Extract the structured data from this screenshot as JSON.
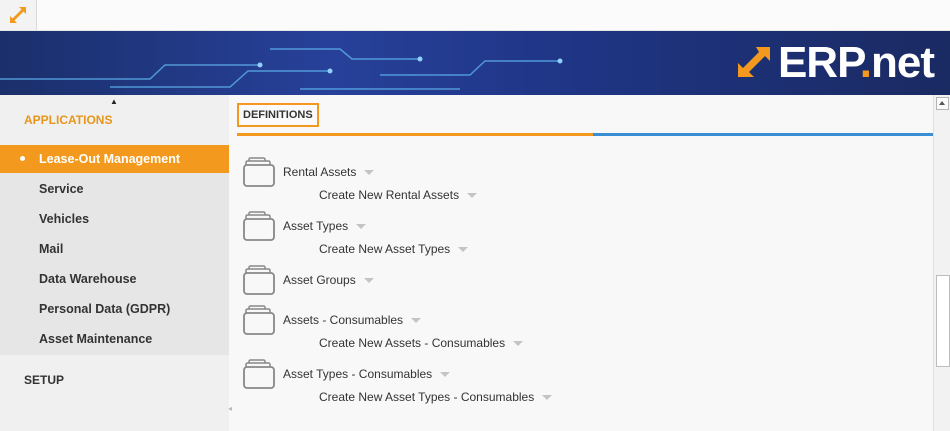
{
  "topbar": {
    "app_button_icon": "expand-arrow-icon"
  },
  "banner": {
    "logo_icon": "erp-logo-arrow-icon",
    "logo_text_main": "ERP",
    "logo_text_dot": ".",
    "logo_text_suffix": "net",
    "colors": {
      "orange": "#f39a1e",
      "navy": "#1f3585"
    }
  },
  "sidebar": {
    "scroll_up_icon": "triangle-up-icon",
    "applications_label": "APPLICATIONS",
    "items": [
      {
        "label": "Lease-Out Management",
        "active": true
      },
      {
        "label": "Service"
      },
      {
        "label": "Vehicles"
      },
      {
        "label": "Mail"
      },
      {
        "label": "Data Warehouse"
      },
      {
        "label": "Personal Data (GDPR)"
      },
      {
        "label": "Asset Maintenance"
      }
    ],
    "setup_label": "SETUP"
  },
  "main": {
    "tab_label": "DEFINITIONS",
    "entries": [
      {
        "title": "Rental Assets",
        "sub": "Create New Rental Assets",
        "icon": "folder-icon"
      },
      {
        "title": "Asset Types",
        "sub": "Create New Asset Types",
        "icon": "folder-icon"
      },
      {
        "title": "Asset Groups",
        "sub": "",
        "icon": "folder-icon"
      },
      {
        "title": "Assets - Consumables",
        "sub": "Create New Assets - Consumables",
        "icon": "folder-icon"
      },
      {
        "title": "Asset Types - Consumables",
        "sub": "Create New Asset Types - Consumables",
        "icon": "folder-icon"
      }
    ],
    "dropdown_icon": "caret-down-icon"
  },
  "colors": {
    "accent": "#f39a1e",
    "blue": "#3a8fd4",
    "sidebar_bg": "#f0f0f0"
  }
}
